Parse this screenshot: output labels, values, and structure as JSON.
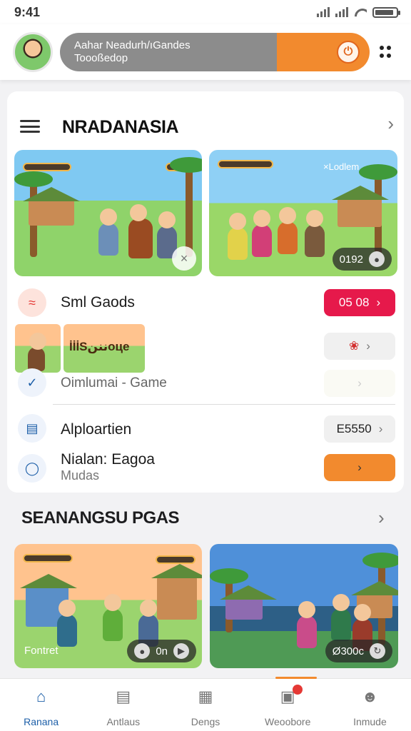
{
  "status_bar": {
    "time": "9:41"
  },
  "header": {
    "banner_line1": "Aahar Neadurh/ıGandes",
    "banner_line2": "Toooßedop",
    "power_symbol": "⏻",
    "colors": {
      "banner_gray": "#8c8c8c",
      "banner_orange": "#f28a2e"
    }
  },
  "section1": {
    "title": "NRADANASIA",
    "chevron": "›",
    "cards": [
      {
        "close_symbol": "×"
      },
      {
        "hud_text": "×Lodlem",
        "chip_text": "0192"
      }
    ],
    "rows": [
      {
        "label": "Sml Gaods",
        "pill_text": "05 08",
        "pill_color": "#e6194b",
        "icon": "wave-icon"
      },
      {
        "image_title": "İİİSنننоцe",
        "pill_symbol": "❀"
      },
      {
        "label": "Oimlumai - Game",
        "icon": "check-icon"
      },
      {
        "label": "Alploartien",
        "pill_text": "E5550",
        "icon": "doc-icon"
      },
      {
        "label": "Nialan: Eagoa",
        "sub": "Mudas",
        "pill_color": "#f28a2e",
        "icon": "chat-icon"
      }
    ]
  },
  "section2": {
    "title": "SEANANGSU PGAS",
    "chevron": "›",
    "cards": [
      {
        "caption": "Fontret",
        "chip_text": "0n"
      },
      {
        "chip_text": "Ø300с"
      }
    ]
  },
  "tabs": [
    {
      "label": "Ranana",
      "icon": "home-icon",
      "active": true
    },
    {
      "label": "Antlaus",
      "icon": "news-icon"
    },
    {
      "label": "Dengs",
      "icon": "games-icon"
    },
    {
      "label": "Weoobore",
      "icon": "image-icon",
      "badge": true
    },
    {
      "label": "Inmude",
      "icon": "profile-icon"
    }
  ]
}
